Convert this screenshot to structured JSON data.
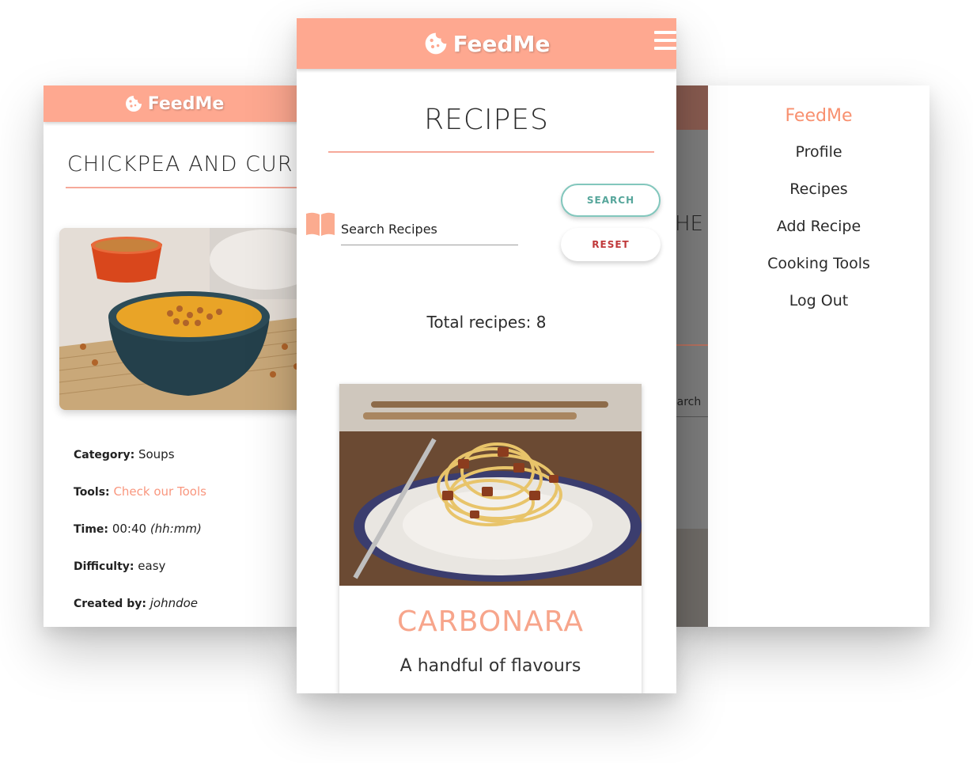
{
  "brand": "FeedMe",
  "detail_screen": {
    "title": "CHICKPEA AND CUR",
    "details": [
      {
        "label": "Category:",
        "value": "Soups"
      },
      {
        "label": "Tools:",
        "value": "Check our Tools"
      },
      {
        "label": "Time:",
        "value": "00:40",
        "note": "(hh:mm)"
      },
      {
        "label": "Difficulty:",
        "value": "easy"
      },
      {
        "label": "Created by:",
        "value": "johndoe"
      }
    ]
  },
  "list_screen": {
    "heading": "RECIPES",
    "search": {
      "placeholder": "Search Recipes"
    },
    "buttons": {
      "search": "SEARCH",
      "reset": "RESET"
    },
    "total": "Total recipes: 8",
    "card": {
      "title": "CARBONARA",
      "subtitle": "A handful of flavours"
    }
  },
  "menu_screen": {
    "brand": "FeedMe",
    "items": [
      "Profile",
      "Recipes",
      "Add Recipe",
      "Cooking Tools",
      "Log Out"
    ],
    "dimmed_heading_fragment": "HE",
    "dimmed_search_fragment": "earch"
  },
  "colors": {
    "header": "#fea890",
    "accent": "#f8906f",
    "search_button": "#82c7bd",
    "reset_button": "#c0393b"
  }
}
